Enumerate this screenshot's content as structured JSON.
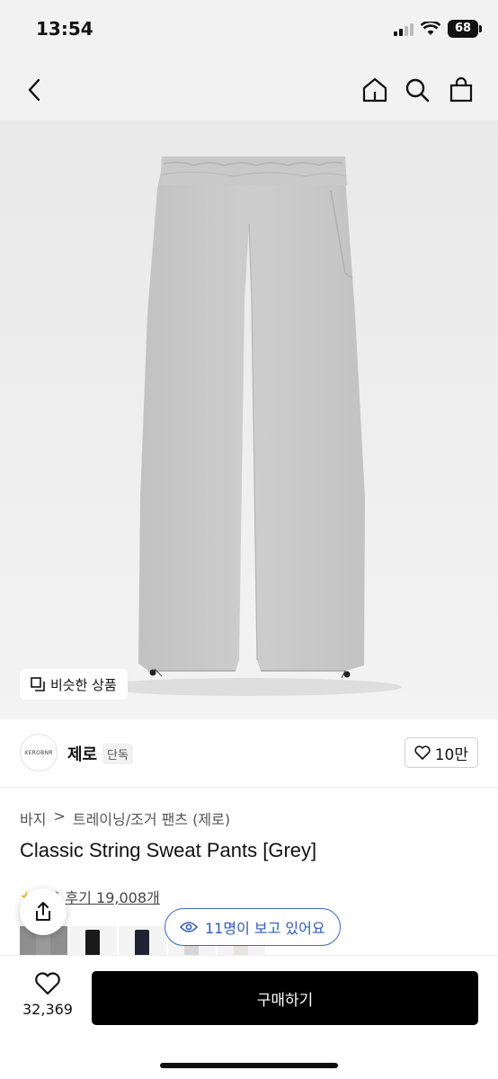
{
  "status": {
    "time": "13:54",
    "battery": "68"
  },
  "hero": {
    "similar_label": "비슷한 상품"
  },
  "brand": {
    "logo_text": "XEROBNR",
    "name": "제로",
    "tag": "단독",
    "likes": "10만"
  },
  "breadcrumb": [
    "바지",
    ">",
    "트레이닝/조거 팬츠 (제로)"
  ],
  "product": {
    "title": "Classic String Sweat Pants [Grey]"
  },
  "rating": {
    "score_fragment": "3",
    "reviews": "후기 19,008개"
  },
  "viewers": {
    "text": "11명이 보고 있어요"
  },
  "thumbs": [
    {
      "name": "grey",
      "color": "#9a9a9a"
    },
    {
      "name": "black",
      "color": "#1a1a1a"
    },
    {
      "name": "navy",
      "color": "#1e2433"
    },
    {
      "name": "light-grey",
      "color": "#d5d5d5"
    },
    {
      "name": "cream",
      "color": "#e6e4df"
    }
  ],
  "bottom": {
    "wish_count": "32,369",
    "buy_label": "구매하기"
  },
  "colors": {
    "accent": "#2e5bbd",
    "buy_bg": "#000000",
    "star": "#f4b400"
  }
}
